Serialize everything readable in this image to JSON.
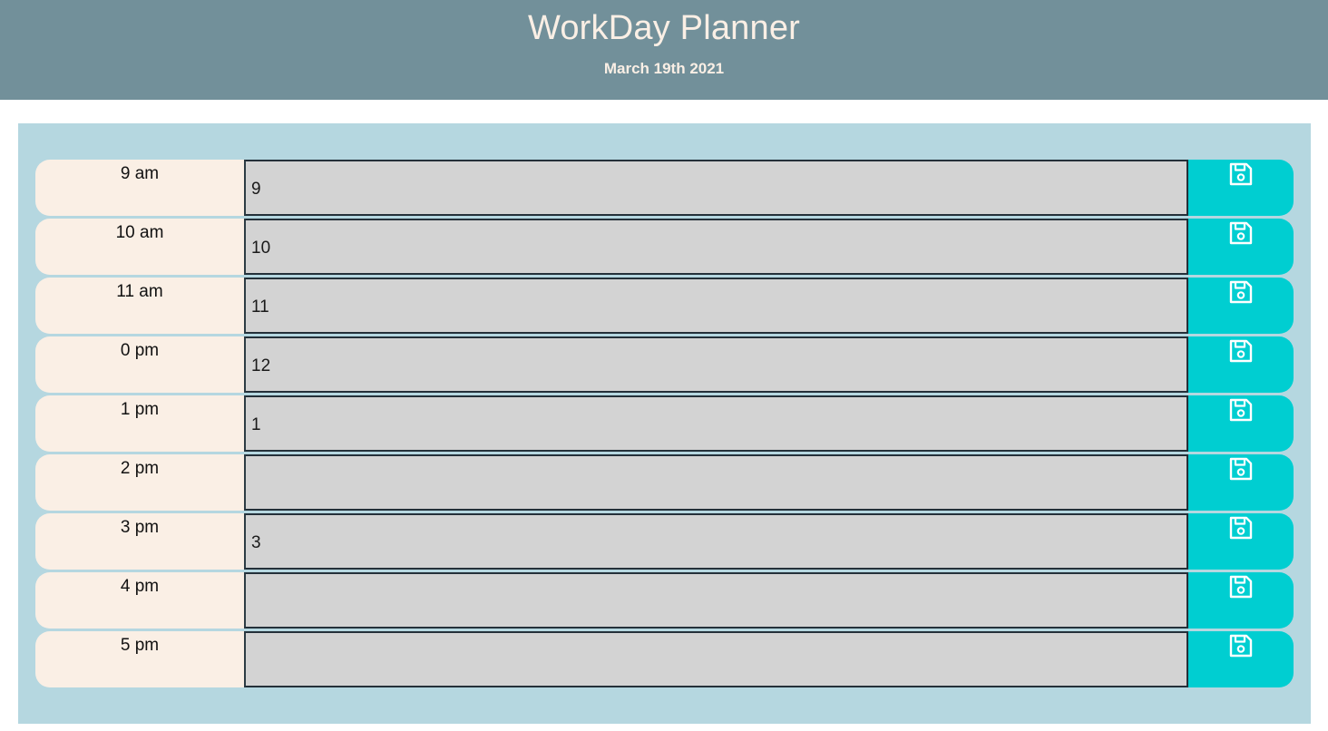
{
  "header": {
    "title": "WorkDay Planner",
    "date": "March 19th 2021"
  },
  "icons": {
    "save": "floppy-disk-icon"
  },
  "colors": {
    "header_bg": "#72909a",
    "header_text": "#faefe5",
    "container_bg": "#b5d7e0",
    "hour_bg": "#faefe5",
    "textarea_bg": "#d3d3d3",
    "save_bg": "#00ced1"
  },
  "rows": [
    {
      "hour": "9 am",
      "text": "9"
    },
    {
      "hour": "10 am",
      "text": "10"
    },
    {
      "hour": "11 am",
      "text": "11"
    },
    {
      "hour": "0 pm",
      "text": "12"
    },
    {
      "hour": "1 pm",
      "text": "1"
    },
    {
      "hour": "2 pm",
      "text": ""
    },
    {
      "hour": "3 pm",
      "text": "3"
    },
    {
      "hour": "4 pm",
      "text": ""
    },
    {
      "hour": "5 pm",
      "text": ""
    }
  ]
}
